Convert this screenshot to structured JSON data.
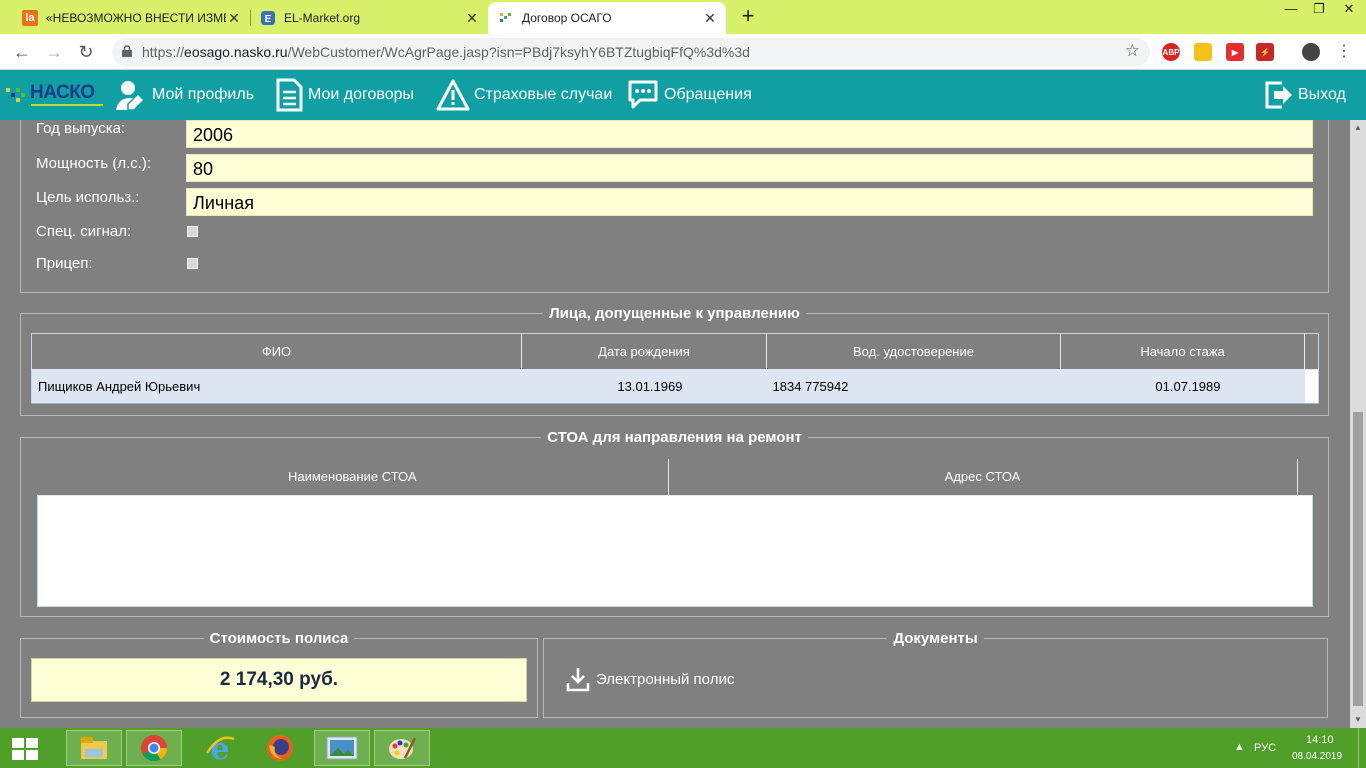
{
  "browser": {
    "tabs": [
      {
        "title": "«НЕВОЗМОЖНО ВНЕСТИ ИЗМЕ",
        "icon": "la-favicon",
        "active": false
      },
      {
        "title": "EL-Market.org",
        "icon": "el-market-favicon",
        "active": false
      },
      {
        "title": "Договор ОСАГО",
        "icon": "nasko-favicon",
        "active": true
      }
    ],
    "url_scheme": "https://",
    "url_host": "eosago.nasko.ru",
    "url_path": "/WebCustomer/WcAgrPage.jasp?isn=PBdj7ksyhY6BTZtugbiqFfQ%3d%3d",
    "extension_abp": "ABP"
  },
  "header": {
    "logo_text": "НАСКО",
    "nav": [
      {
        "label": "Мой профиль",
        "icon": "user-edit-icon"
      },
      {
        "label": "Мои договоры",
        "icon": "document-icon"
      },
      {
        "label": "Страховые случаи",
        "icon": "warning-icon"
      },
      {
        "label": "Обращения",
        "icon": "chat-icon"
      }
    ],
    "logout_label": "Выход"
  },
  "vehicle": {
    "year_label": "Год выпуска:",
    "year_value": "2006",
    "power_label": "Мощность (л.с.):",
    "power_value": "80",
    "purpose_label": "Цель использ.:",
    "purpose_value": "Личная",
    "signal_label": "Спец. сигнал:",
    "signal_checked": false,
    "trailer_label": "Прицеп:",
    "trailer_checked": false
  },
  "drivers": {
    "legend": "Лица, допущенные к управлению",
    "columns": [
      "ФИО",
      "Дата рождения",
      "Вод. удостоверение",
      "Начало стажа"
    ],
    "rows": [
      {
        "name": "Пищиков Андрей Юрьевич",
        "birth": "13.01.1969",
        "license": "1834 775942",
        "exp_start": "01.07.1989"
      }
    ]
  },
  "stoa": {
    "legend": "СТОА для направления на ремонт",
    "columns": [
      "Наименование СТОА",
      "Адрес СТОА"
    ]
  },
  "price": {
    "legend": "Стоимость полиса",
    "value": "2 174,30 руб."
  },
  "documents": {
    "legend": "Документы",
    "link_label": "Электронный полис"
  },
  "taskbar": {
    "lang": "РУС",
    "time": "14:10",
    "date": "08.04.2019"
  },
  "colors": {
    "header_teal": "#109fa3",
    "tabbar_lime": "#d9f06a",
    "content_gray": "#808080",
    "field_yellow": "#ffffd8",
    "taskbar_green": "#4f9f28"
  }
}
